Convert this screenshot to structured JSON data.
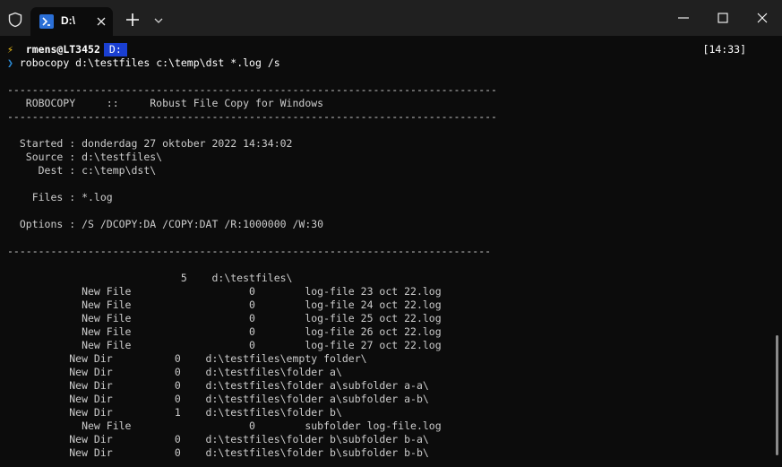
{
  "tab": {
    "title": "D:\\"
  },
  "icons": {
    "shield": "shield-icon",
    "powershell": "powershell-icon",
    "close_tab": "close-icon",
    "new_tab": "plus-icon",
    "dropdown": "chevron-down-icon",
    "minimize": "minimize-icon",
    "maximize": "maximize-icon",
    "close_window": "close-icon"
  },
  "prompt": {
    "bolt": "⚡",
    "user": "rmens@LT3452",
    "drive": "D:",
    "time": "[14:33]",
    "chevron": "❯",
    "command": "robocopy d:\\testfiles c:\\temp\\dst *.log /s"
  },
  "output": [
    "",
    "-------------------------------------------------------------------------------",
    "   ROBOCOPY     ::     Robust File Copy for Windows",
    "-------------------------------------------------------------------------------",
    "",
    "  Started : donderdag 27 oktober 2022 14:34:02",
    "   Source : d:\\testfiles\\",
    "     Dest : c:\\temp\\dst\\",
    "",
    "    Files : *.log",
    "",
    "  Options : /S /DCOPY:DA /COPY:DAT /R:1000000 /W:30",
    "",
    "------------------------------------------------------------------------------",
    "",
    "",
    "                            5    d:\\testfiles\\",
    "            New File                   0        log-file 23 oct 22.log",
    "            New File                   0        log-file 24 oct 22.log",
    "            New File                   0        log-file 25 oct 22.log",
    "            New File                   0        log-file 26 oct 22.log",
    "            New File                   0        log-file 27 oct 22.log",
    "          New Dir          0    d:\\testfiles\\empty folder\\",
    "          New Dir          0    d:\\testfiles\\folder a\\",
    "          New Dir          0    d:\\testfiles\\folder a\\subfolder a-a\\",
    "          New Dir          0    d:\\testfiles\\folder a\\subfolder a-b\\",
    "          New Dir          1    d:\\testfiles\\folder b\\",
    "            New File                   0        subfolder log-file.log",
    "          New Dir          0    d:\\testfiles\\folder b\\subfolder b-a\\",
    "          New Dir          0    d:\\testfiles\\folder b\\subfolder b-b\\"
  ],
  "colors": {
    "background": "#0c0c0c",
    "titlebar": "#202020",
    "text": "#cccccc",
    "drive_badge": "#1a3fd1",
    "bolt": "#f5c518",
    "chevron": "#2b8bd6"
  }
}
